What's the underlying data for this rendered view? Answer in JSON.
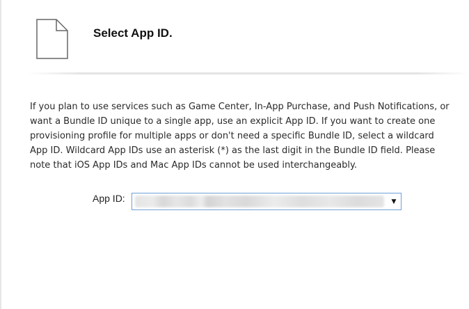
{
  "header": {
    "title": "Select App ID.",
    "icon": "document-icon"
  },
  "description": "If you plan to use services such as Game Center, In-App Purchase, and Push Notifications, or want a Bundle ID unique to a single app, use an explicit App ID. If you want to create one provisioning profile for multiple apps or don't need a specific Bundle ID, select a wildcard App ID. Wildcard App IDs use an asterisk (*) as the last digit in the Bundle ID field. Please note that iOS App IDs and Mac App IDs cannot be used interchangeably.",
  "form": {
    "app_id_label": "App ID:",
    "app_id_value_obscured": true,
    "dropdown_arrow": "▼"
  },
  "colors": {
    "select_border": "#6e9fd6",
    "text": "#222222"
  }
}
